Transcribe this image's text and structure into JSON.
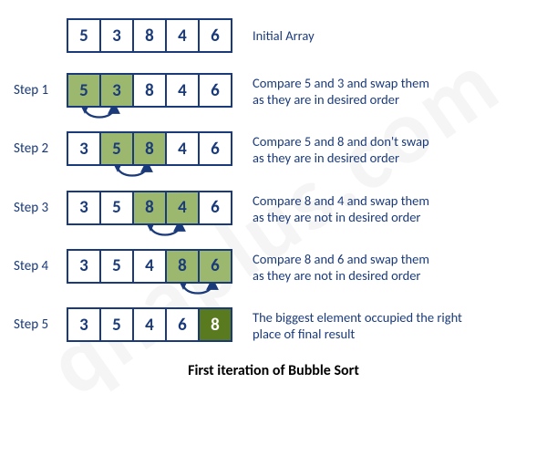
{
  "watermark": "qnaplus.com",
  "caption": "First iteration of Bubble Sort",
  "rows": [
    {
      "step": "",
      "cells": [
        {
          "v": "5",
          "cls": ""
        },
        {
          "v": "3",
          "cls": ""
        },
        {
          "v": "8",
          "cls": ""
        },
        {
          "v": "4",
          "cls": ""
        },
        {
          "v": "6",
          "cls": ""
        }
      ],
      "desc_l1": "Initial Array",
      "desc_l2": "",
      "swap_between": null
    },
    {
      "step": "Step 1",
      "cells": [
        {
          "v": "5",
          "cls": "hl"
        },
        {
          "v": "3",
          "cls": "hl"
        },
        {
          "v": "8",
          "cls": ""
        },
        {
          "v": "4",
          "cls": ""
        },
        {
          "v": "6",
          "cls": ""
        }
      ],
      "desc_l1": "Compare 5 and 3 and swap them",
      "desc_l2": "as they are in desired order",
      "swap_between": 0
    },
    {
      "step": "Step 2",
      "cells": [
        {
          "v": "3",
          "cls": ""
        },
        {
          "v": "5",
          "cls": "hl"
        },
        {
          "v": "8",
          "cls": "hl"
        },
        {
          "v": "4",
          "cls": ""
        },
        {
          "v": "6",
          "cls": ""
        }
      ],
      "desc_l1": "Compare 5 and 8 and don't swap",
      "desc_l2": "as they are in desired order",
      "swap_between": 1
    },
    {
      "step": "Step 3",
      "cells": [
        {
          "v": "3",
          "cls": ""
        },
        {
          "v": "5",
          "cls": ""
        },
        {
          "v": "8",
          "cls": "hl"
        },
        {
          "v": "4",
          "cls": "hl"
        },
        {
          "v": "6",
          "cls": ""
        }
      ],
      "desc_l1": "Compare 8 and 4 and swap them",
      "desc_l2": "as they are not in desired order",
      "swap_between": 2
    },
    {
      "step": "Step 4",
      "cells": [
        {
          "v": "3",
          "cls": ""
        },
        {
          "v": "5",
          "cls": ""
        },
        {
          "v": "4",
          "cls": ""
        },
        {
          "v": "8",
          "cls": "hl"
        },
        {
          "v": "6",
          "cls": "hl"
        }
      ],
      "desc_l1": "Compare 8 and 6 and swap them",
      "desc_l2": "as they are not in desired order",
      "swap_between": 3
    },
    {
      "step": "Step 5",
      "cells": [
        {
          "v": "3",
          "cls": ""
        },
        {
          "v": "5",
          "cls": ""
        },
        {
          "v": "4",
          "cls": ""
        },
        {
          "v": "6",
          "cls": ""
        },
        {
          "v": "8",
          "cls": "final"
        }
      ],
      "desc_l1": "The biggest element occupied the right",
      "desc_l2": "place of final result",
      "swap_between": null
    }
  ],
  "colors": {
    "ink": "#1a3a7a",
    "highlight": "#9cb86f",
    "final": "#5a7a1f"
  },
  "chart_data": {
    "type": "table",
    "title": "First iteration of Bubble Sort",
    "initial_array": [
      5,
      3,
      8,
      4,
      6
    ],
    "steps": [
      {
        "step": 1,
        "array": [
          5,
          3,
          8,
          4,
          6
        ],
        "compare_indices": [
          0,
          1
        ],
        "swap": true,
        "note": "Compare 5 and 3 and swap them as they are in desired order"
      },
      {
        "step": 2,
        "array": [
          3,
          5,
          8,
          4,
          6
        ],
        "compare_indices": [
          1,
          2
        ],
        "swap": false,
        "note": "Compare 5 and 8 and don't swap as they are in desired order"
      },
      {
        "step": 3,
        "array": [
          3,
          5,
          8,
          4,
          6
        ],
        "compare_indices": [
          2,
          3
        ],
        "swap": true,
        "note": "Compare 8 and 4 and swap them as they are not in desired order"
      },
      {
        "step": 4,
        "array": [
          3,
          5,
          4,
          8,
          6
        ],
        "compare_indices": [
          3,
          4
        ],
        "swap": true,
        "note": "Compare 8 and 6 and swap them as they are not in desired order"
      },
      {
        "step": 5,
        "array": [
          3,
          5,
          4,
          6,
          8
        ],
        "sorted_indices": [
          4
        ],
        "note": "The biggest element occupied the right place of final result"
      }
    ]
  }
}
